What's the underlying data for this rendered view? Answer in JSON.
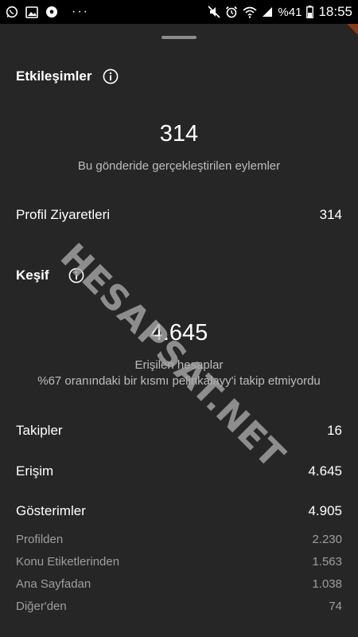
{
  "status_bar": {
    "battery_text": "%41",
    "time": "18:55",
    "more_dots": "···"
  },
  "interactions": {
    "title": "Etkileşimler",
    "total": "314",
    "caption": "Bu gönderide gerçekleştirilen eylemler",
    "rows": [
      {
        "label": "Profil Ziyaretleri",
        "value": "314"
      }
    ]
  },
  "discovery": {
    "title": "Keşif",
    "reach_total": "4.645",
    "reach_caption": "Erişilen hesaplar",
    "non_follower_note": "%67 oranındaki bir kısmı pelinkalayy'i takip etmiyordu",
    "rows": [
      {
        "label": "Takipler",
        "value": "16"
      },
      {
        "label": "Erişim",
        "value": "4.645"
      },
      {
        "label": "Gösterimler",
        "value": "4.905"
      }
    ],
    "sub_rows": [
      {
        "label": "Profilden",
        "value": "2.230"
      },
      {
        "label": "Konu Etiketlerinden",
        "value": "1.563"
      },
      {
        "label": "Ana Sayfadan",
        "value": "1.038"
      },
      {
        "label": "Diğer'den",
        "value": "74"
      }
    ]
  },
  "watermark": "HESAPSAT.NET",
  "colors": {
    "background": "#262626",
    "primary_text": "#ffffff",
    "secondary_text": "#9e9e9e"
  }
}
